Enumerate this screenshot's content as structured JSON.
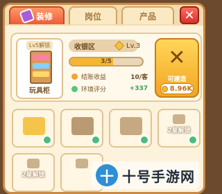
{
  "tabs": [
    {
      "label": "装修",
      "active": true
    },
    {
      "label": "岗位",
      "active": false
    },
    {
      "label": "产品",
      "active": false
    }
  ],
  "close_label": "✕",
  "item": {
    "level_tag": "Lv5解锁",
    "name": "玩具柜",
    "area": "收银区",
    "level": "Lv.3",
    "progress_text": "3/5",
    "progress_fraction": 0.6,
    "stats": [
      {
        "label": "结账收益",
        "value": "10/客",
        "dot_color": "#f0a43a",
        "value_color": "#6b4a24"
      },
      {
        "label": "环境评分",
        "value": "+337",
        "dot_color": "#5bc27a",
        "value_color": "#3aa04f"
      }
    ]
  },
  "build": {
    "icon": "wrench-hammer-icon",
    "label": "可建造",
    "cost": "8.96K"
  },
  "slots": [
    {
      "name": "cash-register",
      "selected": true,
      "icon_color": "#f5c54b",
      "badge": true,
      "lock_text": ""
    },
    {
      "name": "basket",
      "selected": false,
      "icon_color": "#b99a72",
      "badge": true,
      "lock_text": ""
    },
    {
      "name": "shelf",
      "selected": false,
      "icon_color": "#c6a983",
      "badge": true,
      "lock_text": ""
    },
    {
      "name": "locked-2",
      "selected": false,
      "icon_color": "#d8c6a4",
      "badge": true,
      "lock_text": "2星解锁"
    },
    {
      "name": "locked-row2-1",
      "selected": false,
      "icon_color": "#d8c6a4",
      "badge": false,
      "lock_text": "2星解锁"
    },
    {
      "name": "locked-row2-2",
      "selected": false,
      "icon_color": "#d8c6a4",
      "badge": false,
      "lock_text": ""
    }
  ],
  "watermark": {
    "logo": "十",
    "text": "十号手游网"
  }
}
